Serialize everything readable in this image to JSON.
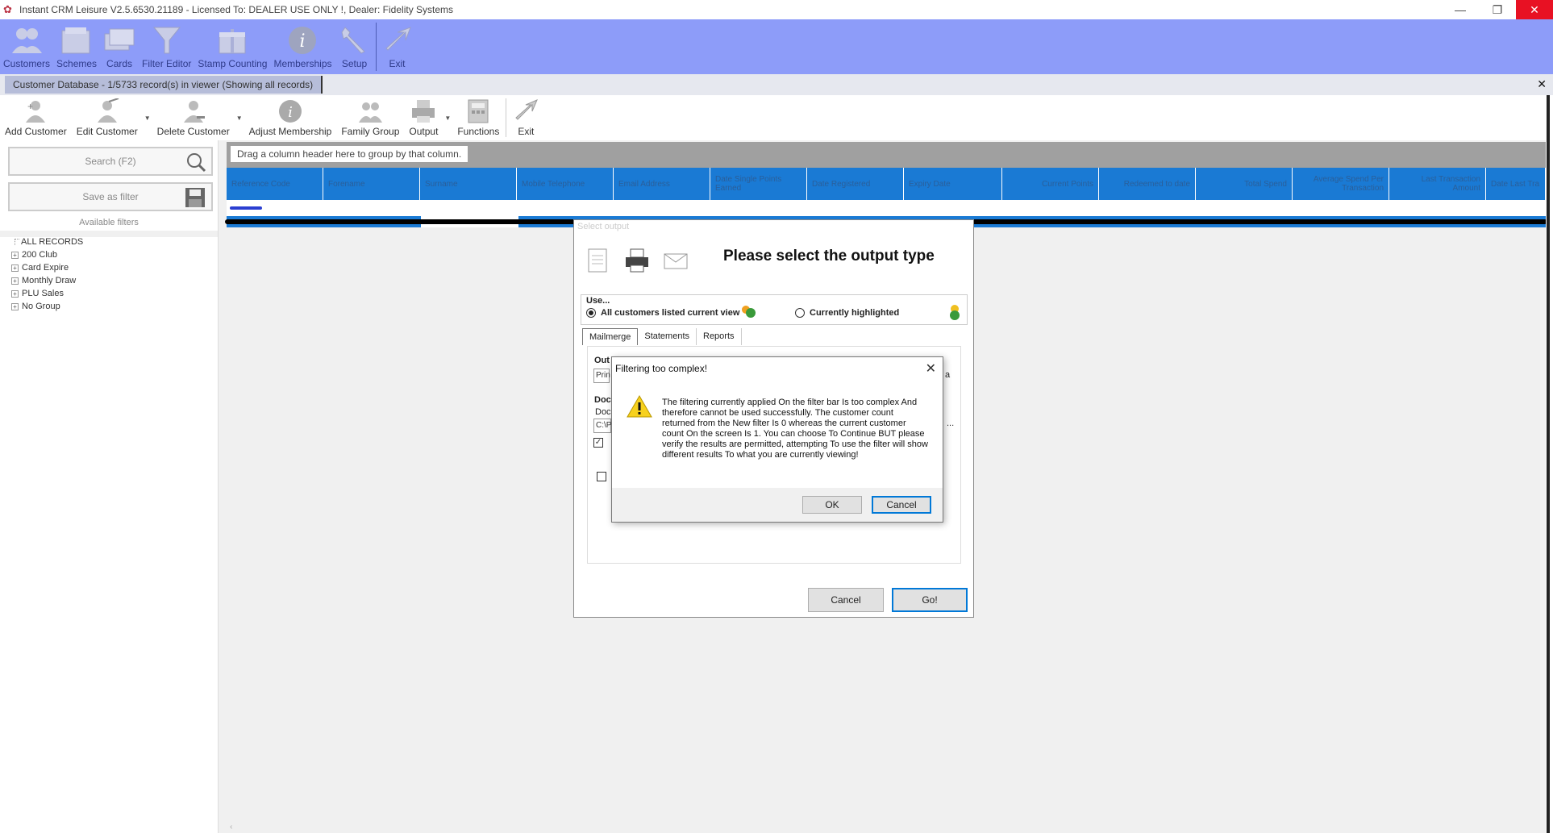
{
  "window": {
    "title": "Instant CRM Leisure V2.5.6530.21189 - Licensed To: DEALER USE ONLY !, Dealer: Fidelity Systems",
    "minimize": "—",
    "restore": "❐",
    "close": "✕"
  },
  "main_toolbar": {
    "items": [
      {
        "label": "Customers",
        "icon": "customers-icon"
      },
      {
        "label": "Schemes",
        "icon": "folder-icon"
      },
      {
        "label": "Cards",
        "icon": "cards-icon"
      },
      {
        "label": "Filter Editor",
        "icon": "funnel-icon"
      },
      {
        "label": "Stamp Counting",
        "icon": "gift-icon"
      },
      {
        "label": "Memberships",
        "icon": "info-icon"
      },
      {
        "label": "Setup",
        "icon": "wrench-icon"
      },
      {
        "label": "Exit",
        "icon": "exit-icon"
      }
    ]
  },
  "doc_tab": {
    "label": "Customer Database - 1/5733 record(s) in viewer (Showing all records)",
    "close": "✕"
  },
  "sub_toolbar": {
    "items": [
      {
        "label": "Add Customer"
      },
      {
        "label": "Edit Customer"
      },
      {
        "label": "Delete Customer"
      },
      {
        "label": "Adjust Membership"
      },
      {
        "label": "Family Group"
      },
      {
        "label": "Output"
      },
      {
        "label": "Functions"
      },
      {
        "label": "Exit"
      }
    ]
  },
  "left_panel": {
    "search_placeholder": "Search (F2)",
    "save_filter": "Save as filter",
    "available_filters": "Available filters",
    "tree": {
      "root": "ALL RECORDS",
      "items": [
        "200 Club",
        "Card Expire",
        "Monthly Draw",
        "PLU Sales",
        "No Group"
      ]
    }
  },
  "grid": {
    "group_hint": "Drag a column header here to group by that column.",
    "columns": [
      "Reference Code",
      "Forename",
      "Surname",
      "Mobile Telephone",
      "Email Address",
      "Date Single Points Earned",
      "Date Registered",
      "Expiry Date",
      "Current Points",
      "Redeemed to date",
      "Total Spend",
      "Average Spend Per Transaction",
      "Last Transaction Amount",
      "Date Last Tra"
    ]
  },
  "select_output_dialog": {
    "title": "Select output",
    "heading": "Please select the output type",
    "use_label": "Use...",
    "radio_all": "All customers listed current view",
    "radio_highlighted": "Currently highlighted",
    "tabs": [
      "Mailmerge",
      "Statements",
      "Reports"
    ],
    "partial_output_label": "Out",
    "partial_output_value": "Prin",
    "partial_doc_label": "Doc",
    "partial_doc_sub": "Doc",
    "partial_doc_path": "C:\\P",
    "partial_right_1": "a",
    "partial_right_2": "...",
    "cancel": "Cancel",
    "go": "Go!"
  },
  "error_dialog": {
    "title": "Filtering too complex!",
    "close": "✕",
    "message": "The filtering currently applied On the filter bar Is too complex And therefore cannot be used successfully. The customer count returned from the New filter Is 0 whereas the current customer count On the screen Is 1. You can choose To Continue BUT please verify the results are permitted, attempting To use the filter will show different results To what you are currently viewing!",
    "ok": "OK",
    "cancel": "Cancel"
  }
}
